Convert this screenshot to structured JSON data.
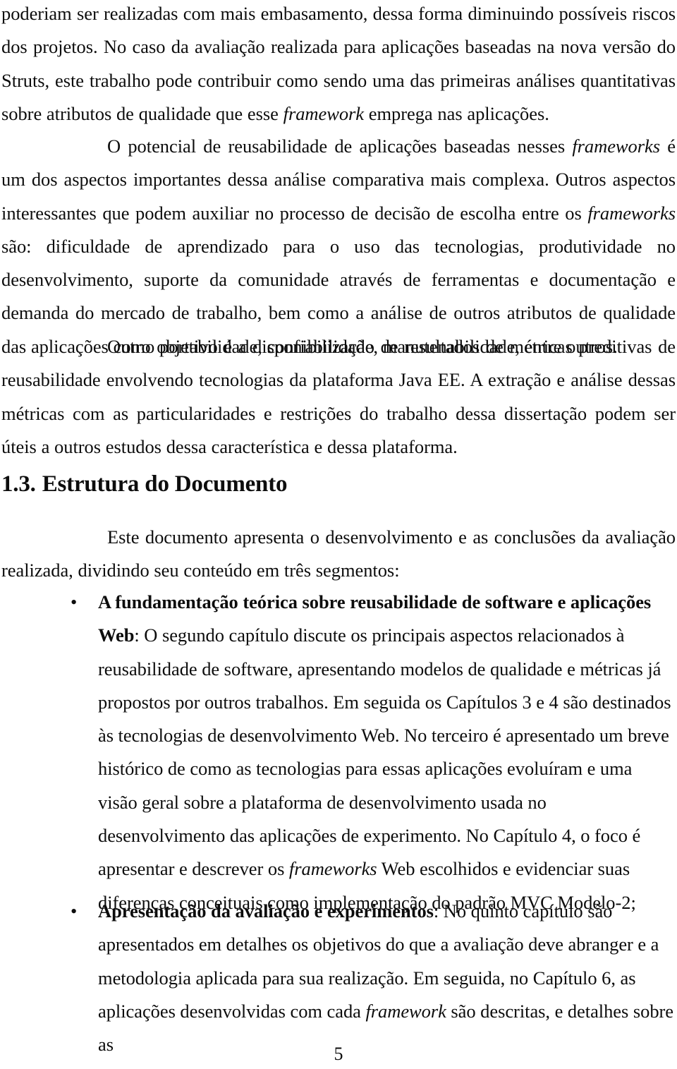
{
  "document": {
    "language": "pt-BR",
    "page_number": "5",
    "text_color": "#0d0d0d",
    "background_color": "#ffffff"
  },
  "paragraphs": {
    "continuation": {
      "lead": "poderiam ser realizadas com mais embasamento, dessa forma diminuindo possíveis riscos dos projetos. ",
      "rest_before_italic": "No caso da avaliação realizada para aplicações baseadas na nova versão do Struts, este trabalho pode contribuir como sendo uma das primeiras análises quantitativas sobre atributos de qualidade que esse ",
      "italic_1": "framework",
      "tail": " emprega nas aplicações."
    },
    "potencial": {
      "part_1": "O potencial de reusabilidade de aplicações baseadas nesses ",
      "italic_1": "frameworks",
      "part_2": " é um dos aspectos importantes dessa análise comparativa mais complexa. Outros aspectos interessantes que podem auxiliar no processo de decisão de escolha entre os ",
      "italic_2": "frameworks",
      "part_3": " são: dificuldade de aprendizado para o uso das tecnologias, produtividade no desenvolvimento, suporte da comunidade através de ferramentas e documentação e demanda do mercado de trabalho, bem como a análise de outros atributos de qualidade das aplicações como portabilidade, confiabilidade, manutenabilidade, entre outros."
    },
    "outro_objetivo": {
      "text": "Outro objetivo é a disponibilização de resultados de métricas preditivas de reusabilidade envolvendo tecnologias da plataforma Java EE. A extração e análise dessas métricas com as particularidades e restrições do trabalho dessa dissertação podem ser úteis a outros estudos dessa característica e dessa plataforma."
    },
    "este_documento": {
      "text": "Este documento apresenta o desenvolvimento e as conclusões da avaliação realizada, dividindo seu conteúdo em três segmentos:"
    }
  },
  "heading": {
    "number": "1.3.",
    "title": "Estrutura do Documento"
  },
  "bullets": {
    "marker": "•",
    "items": [
      {
        "label": "A fundamentação teórica sobre reusabilidade de software e aplicações Web",
        "separator": ": ",
        "body_part_1": "O segundo capítulo discute os principais aspectos relacionados à reusabilidade de software, apresentando modelos de qualidade e métricas já propostos por outros trabalhos. Em seguida os Capítulos 3 e 4 são destinados às tecnologias de desenvolvimento Web. No terceiro é apresentado um breve histórico de como as tecnologias para essas aplicações evoluíram e uma visão geral sobre a plataforma de desenvolvimento usada no desenvolvimento das aplicações de experimento. No Capítulo 4, o foco é apresentar e descrever os ",
        "italic_1": "frameworks",
        "body_part_2": " Web escolhidos e evidenciar suas diferenças conceituais como implementação do padrão MVC Modelo-2;"
      },
      {
        "label": "Apresentação da avaliação e experimentos",
        "separator": ": ",
        "body_part_1": "No quinto capítulo são apresentados em detalhes os objetivos do que a avaliação deve abranger e a metodologia aplicada para sua realização. Em seguida, no Capítulo 6, as aplicações desenvolvidas com cada ",
        "italic_1": "framework",
        "body_part_2": " são descritas, e detalhes sobre as"
      }
    ]
  }
}
